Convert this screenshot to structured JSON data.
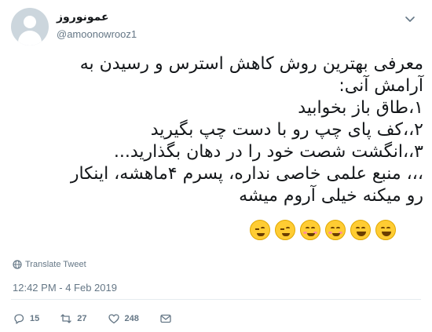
{
  "user": {
    "display_name": "عمونوروز",
    "handle": "@amoonowrooz1"
  },
  "tweet": {
    "lines": [
      "معرفی بهترین روش کاهش استرس و رسیدن به",
      "آرامش آنی:",
      "۱،طاق باز بخوابید",
      "۲،،کف پای چپ رو با دست چپ بگیرید",
      "۳،،انگشت شصت خود را در دهان بگذارید...",
      "،،، منبع علمی خاصی نداره، پسرم ۴ماهشه، اینکار",
      "رو میکنه خیلی آروم میشه"
    ],
    "emojis": [
      "winking-face",
      "winking-face",
      "smiling-face-with-smiling-eyes",
      "smiling-face-with-smiling-eyes",
      "grinning-face",
      "grinning-face"
    ]
  },
  "translate_label": "Translate Tweet",
  "timestamp": "12:42 PM - 4 Feb 2019",
  "actions": {
    "reply_count": "15",
    "retweet_count": "27",
    "like_count": "248"
  },
  "colors": {
    "text": "#14171a",
    "muted": "#657786",
    "divider": "#e6ecf0",
    "avatar_bg": "#ccd6dd"
  }
}
